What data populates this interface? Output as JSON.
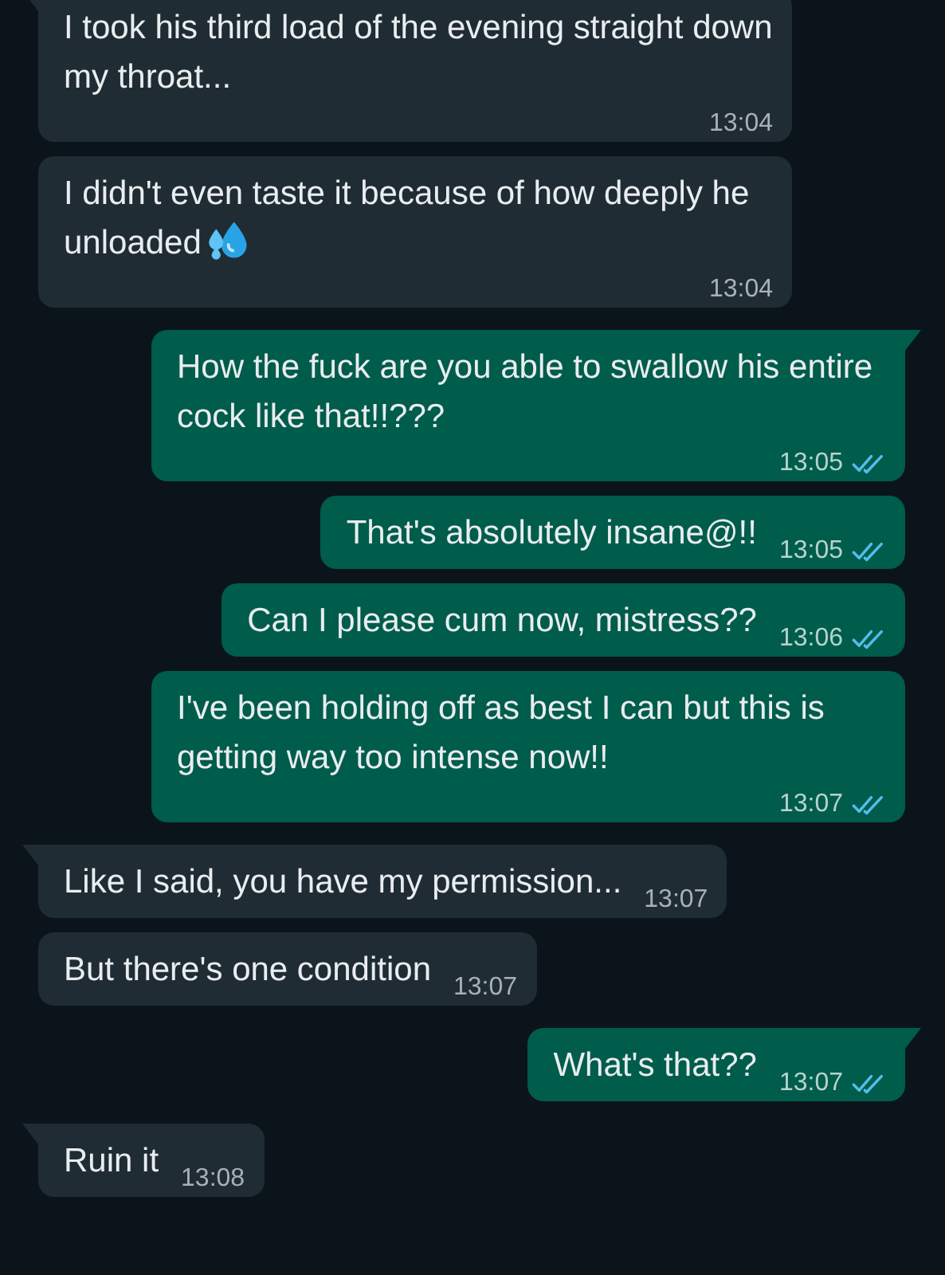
{
  "messages": [
    {
      "kind": "received",
      "tail": true,
      "text": "I took his third load of the evening straight down my throat...",
      "time": "13:04"
    },
    {
      "kind": "received",
      "tail": false,
      "text": "I didn't even taste it because of how deeply he unloaded",
      "droplets_emoji": true,
      "time": "13:04"
    },
    {
      "kind": "sent",
      "tail": true,
      "text": "How the fuck are you able to swallow his entire cock like that!!???",
      "time": "13:05",
      "read": true
    },
    {
      "kind": "sent",
      "tail": false,
      "text": "That's absolutely insane@!!",
      "time": "13:05",
      "read": true
    },
    {
      "kind": "sent",
      "tail": false,
      "text": "Can I please cum now, mistress??",
      "time": "13:06",
      "read": true
    },
    {
      "kind": "sent",
      "tail": false,
      "text": "I've been holding off as best I can but this is getting way too intense now!!",
      "time": "13:07",
      "read": true
    },
    {
      "kind": "received",
      "tail": true,
      "text": "Like I said, you have my permission...",
      "time": "13:07"
    },
    {
      "kind": "received",
      "tail": false,
      "text": "But there's one condition",
      "time": "13:07"
    },
    {
      "kind": "sent",
      "tail": true,
      "text": "What's that??",
      "time": "13:07",
      "read": true
    },
    {
      "kind": "received",
      "tail": true,
      "text": "Ruin it",
      "time": "13:08"
    }
  ]
}
